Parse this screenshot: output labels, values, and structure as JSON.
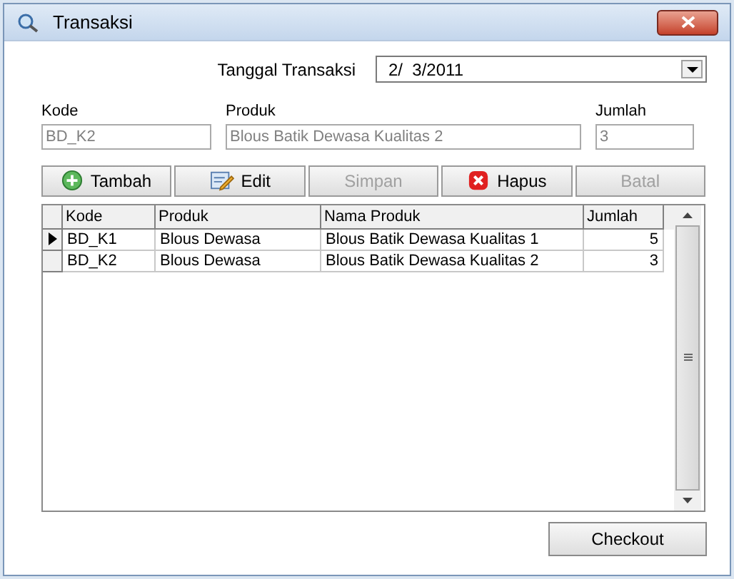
{
  "window": {
    "title": "Transaksi"
  },
  "date": {
    "label": "Tanggal Transaksi",
    "value": "2/  3/2011"
  },
  "fields": [
    {
      "label": "Kode",
      "value": "BD_K2",
      "disabled": true
    },
    {
      "label": "Produk",
      "value": "Blous Batik Dewasa Kualitas 2",
      "disabled": true
    },
    {
      "label": "Jumlah",
      "value": "3",
      "disabled": true
    }
  ],
  "toolbar": [
    {
      "label": "Tambah",
      "kind": "add",
      "disabled": false
    },
    {
      "label": "Edit",
      "kind": "edit",
      "disabled": false
    },
    {
      "label": "Simpan",
      "kind": "none",
      "disabled": true
    },
    {
      "label": "Hapus",
      "kind": "delete",
      "disabled": false
    },
    {
      "label": "Batal",
      "kind": "none",
      "disabled": true
    }
  ],
  "table": {
    "columns": [
      "Kode",
      "Produk",
      "Nama Produk",
      "Jumlah"
    ],
    "rows": [
      {
        "current": true,
        "cells": [
          "BD_K1",
          "Blous Dewasa",
          "Blous Batik Dewasa Kualitas 1",
          "5"
        ]
      },
      {
        "current": false,
        "cells": [
          "BD_K2",
          "Blous Dewasa",
          "Blous Batik Dewasa Kualitas 2",
          "3"
        ]
      }
    ]
  },
  "checkout": {
    "label": "Checkout"
  }
}
